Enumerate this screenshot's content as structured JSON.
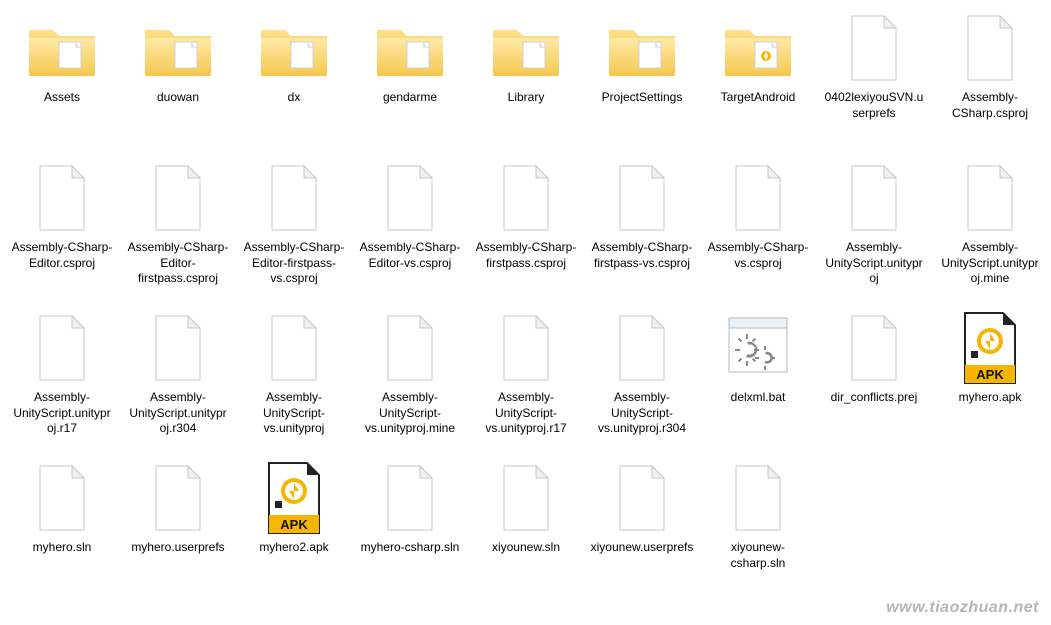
{
  "watermark": "www.tiaozhuan.net",
  "items": [
    {
      "type": "folder",
      "label": "Assets"
    },
    {
      "type": "folder",
      "label": "duowan"
    },
    {
      "type": "folder",
      "label": "dx"
    },
    {
      "type": "folder",
      "label": "gendarme"
    },
    {
      "type": "folder",
      "label": "Library"
    },
    {
      "type": "folder",
      "label": "ProjectSettings"
    },
    {
      "type": "folder-icon",
      "label": "TargetAndroid"
    },
    {
      "type": "file",
      "label": "0402lexiyouSVN.userprefs"
    },
    {
      "type": "file",
      "label": "Assembly-CSharp.csproj"
    },
    {
      "type": "file",
      "label": "Assembly-CSharp-Editor.csproj"
    },
    {
      "type": "file",
      "label": "Assembly-CSharp-Editor-firstpass.csproj"
    },
    {
      "type": "file",
      "label": "Assembly-CSharp-Editor-firstpass-vs.csproj"
    },
    {
      "type": "file",
      "label": "Assembly-CSharp-Editor-vs.csproj"
    },
    {
      "type": "file",
      "label": "Assembly-CSharp-firstpass.csproj"
    },
    {
      "type": "file",
      "label": "Assembly-CSharp-firstpass-vs.csproj"
    },
    {
      "type": "file",
      "label": "Assembly-CSharp-vs.csproj"
    },
    {
      "type": "file",
      "label": "Assembly-UnityScript.unityproj"
    },
    {
      "type": "file",
      "label": "Assembly-UnityScript.unityproj.mine"
    },
    {
      "type": "file",
      "label": "Assembly-UnityScript.unityproj.r17"
    },
    {
      "type": "file",
      "label": "Assembly-UnityScript.unityproj.r304"
    },
    {
      "type": "file",
      "label": "Assembly-UnityScript-vs.unityproj"
    },
    {
      "type": "file",
      "label": "Assembly-UnityScript-vs.unityproj.mine"
    },
    {
      "type": "file",
      "label": "Assembly-UnityScript-vs.unityproj.r17"
    },
    {
      "type": "file",
      "label": "Assembly-UnityScript-vs.unityproj.r304"
    },
    {
      "type": "bat",
      "label": "delxml.bat"
    },
    {
      "type": "file",
      "label": "dir_conflicts.prej"
    },
    {
      "type": "apk",
      "label": "myhero.apk"
    },
    {
      "type": "file",
      "label": "myhero.sln"
    },
    {
      "type": "file",
      "label": "myhero.userprefs"
    },
    {
      "type": "apk",
      "label": "myhero2.apk"
    },
    {
      "type": "file",
      "label": "myhero-csharp.sln"
    },
    {
      "type": "file",
      "label": "xiyounew.sln"
    },
    {
      "type": "file",
      "label": "xiyounew.userprefs"
    },
    {
      "type": "file",
      "label": "xiyounew-csharp.sln"
    }
  ]
}
